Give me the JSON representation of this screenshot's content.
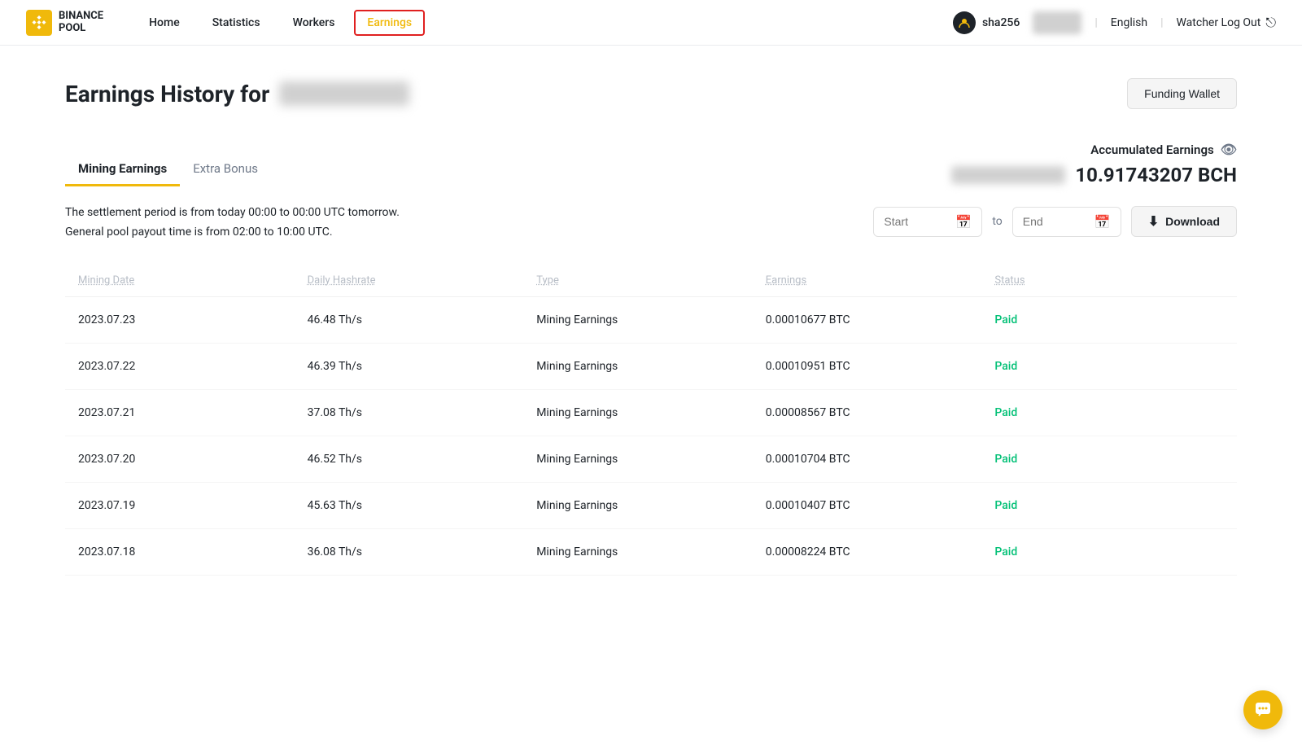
{
  "header": {
    "logo": {
      "line1": "BINANCE",
      "line2": "POOL"
    },
    "nav": [
      {
        "label": "Home",
        "active": false
      },
      {
        "label": "Statistics",
        "active": false
      },
      {
        "label": "Workers",
        "active": false
      },
      {
        "label": "Earnings",
        "active": true
      }
    ],
    "username": "sha256",
    "language": "English",
    "watcher_logout": "Watcher Log Out"
  },
  "page": {
    "title_prefix": "Earnings History for",
    "funding_wallet_label": "Funding Wallet"
  },
  "tabs": [
    {
      "label": "Mining Earnings",
      "active": true
    },
    {
      "label": "Extra Bonus",
      "active": false
    }
  ],
  "accumulated": {
    "label": "Accumulated Earnings",
    "value": "10.91743207 BCH"
  },
  "info": {
    "settlement": "The settlement period is from today 00:00 to 00:00 UTC tomorrow.",
    "payout": "General pool payout time is from 02:00 to 10:00 UTC."
  },
  "date_range": {
    "start_placeholder": "Start",
    "end_placeholder": "End",
    "to_label": "to",
    "download_label": "Download"
  },
  "table": {
    "columns": [
      "Mining Date",
      "Daily Hashrate",
      "Type",
      "Earnings",
      "Status"
    ],
    "rows": [
      {
        "date": "2023.07.23",
        "hashrate": "46.48 Th/s",
        "type": "Mining Earnings",
        "earnings": "0.00010677 BTC",
        "status": "Paid"
      },
      {
        "date": "2023.07.22",
        "hashrate": "46.39 Th/s",
        "type": "Mining Earnings",
        "earnings": "0.00010951 BTC",
        "status": "Paid"
      },
      {
        "date": "2023.07.21",
        "hashrate": "37.08 Th/s",
        "type": "Mining Earnings",
        "earnings": "0.00008567 BTC",
        "status": "Paid"
      },
      {
        "date": "2023.07.20",
        "hashrate": "46.52 Th/s",
        "type": "Mining Earnings",
        "earnings": "0.00010704 BTC",
        "status": "Paid"
      },
      {
        "date": "2023.07.19",
        "hashrate": "45.63 Th/s",
        "type": "Mining Earnings",
        "earnings": "0.00010407 BTC",
        "status": "Paid"
      },
      {
        "date": "2023.07.18",
        "hashrate": "36.08 Th/s",
        "type": "Mining Earnings",
        "earnings": "0.00008224 BTC",
        "status": "Paid"
      }
    ]
  },
  "colors": {
    "brand_yellow": "#f0b90b",
    "paid_green": "#02c076",
    "active_red_border": "#e02020"
  }
}
